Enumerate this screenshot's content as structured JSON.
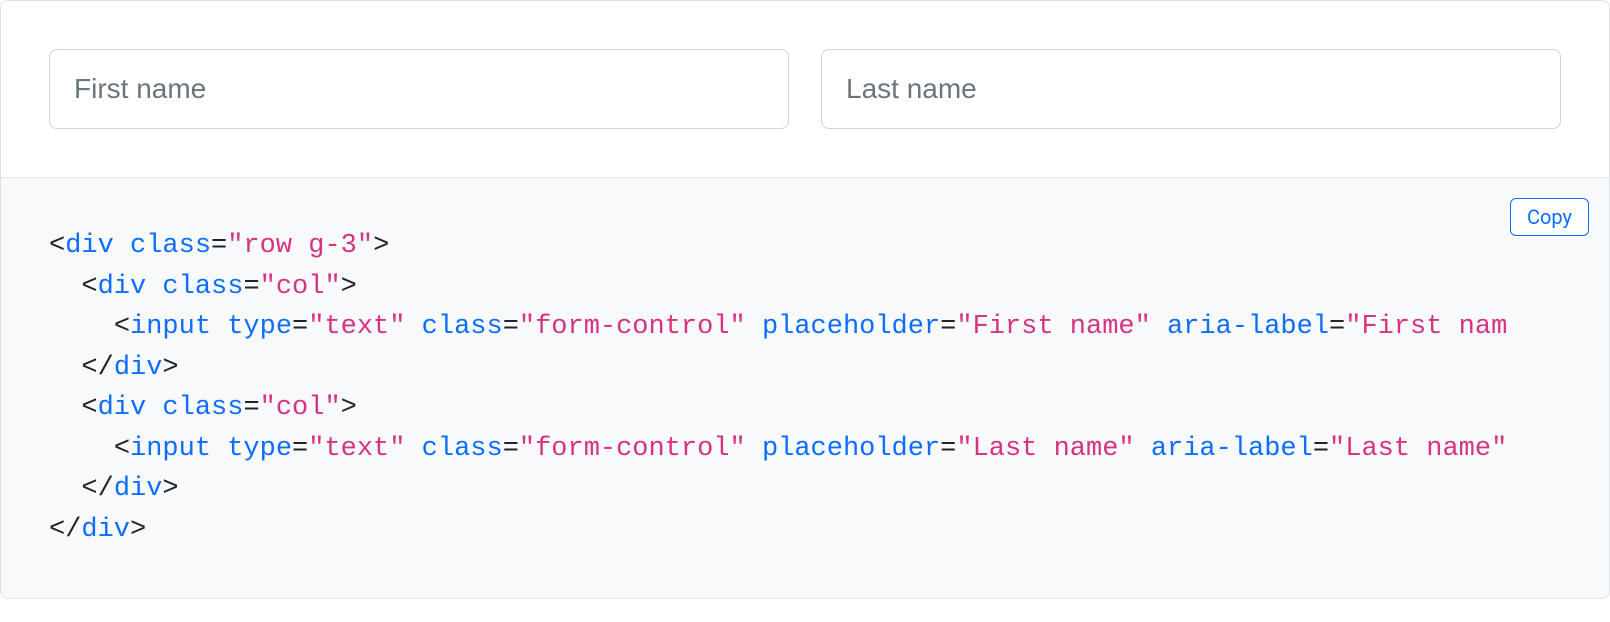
{
  "example": {
    "first_name_placeholder": "First name",
    "last_name_placeholder": "Last name"
  },
  "copy_label": "Copy",
  "code": {
    "l1": {
      "open": "<",
      "tag": "div",
      "sp": " ",
      "attr": "class",
      "eq": "=",
      "val": "\"row g-3\"",
      "close": ">"
    },
    "l2": {
      "indent": "  ",
      "open": "<",
      "tag": "div",
      "sp": " ",
      "attr": "class",
      "eq": "=",
      "val": "\"col\"",
      "close": ">"
    },
    "l3": {
      "indent": "    ",
      "open": "<",
      "tag": "input",
      "sp": " ",
      "a1": "type",
      "e1": "=",
      "v1": "\"text\"",
      "s1": " ",
      "a2": "class",
      "e2": "=",
      "v2": "\"form-control\"",
      "s2": " ",
      "a3": "placeholder",
      "e3": "=",
      "v3": "\"First name\"",
      "s3": " ",
      "a4": "aria-label",
      "e4": "=",
      "v4": "\"First nam"
    },
    "l4": {
      "indent": "  ",
      "open": "</",
      "tag": "div",
      "close": ">"
    },
    "l5": {
      "indent": "  ",
      "open": "<",
      "tag": "div",
      "sp": " ",
      "attr": "class",
      "eq": "=",
      "val": "\"col\"",
      "close": ">"
    },
    "l6": {
      "indent": "    ",
      "open": "<",
      "tag": "input",
      "sp": " ",
      "a1": "type",
      "e1": "=",
      "v1": "\"text\"",
      "s1": " ",
      "a2": "class",
      "e2": "=",
      "v2": "\"form-control\"",
      "s2": " ",
      "a3": "placeholder",
      "e3": "=",
      "v3": "\"Last name\"",
      "s3": " ",
      "a4": "aria-label",
      "e4": "=",
      "v4": "\"Last name\""
    },
    "l7": {
      "indent": "  ",
      "open": "</",
      "tag": "div",
      "close": ">"
    },
    "l8": {
      "open": "</",
      "tag": "div",
      "close": ">"
    }
  }
}
